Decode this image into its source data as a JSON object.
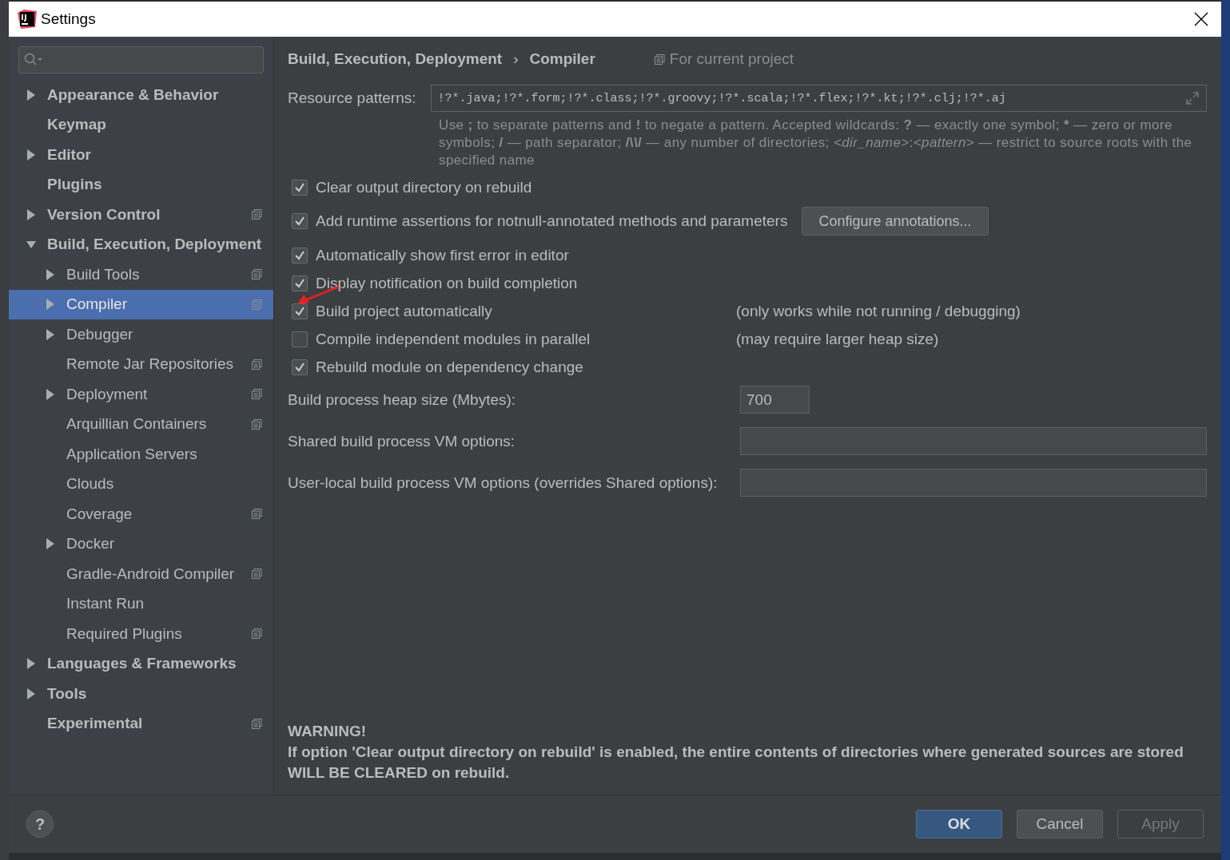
{
  "window": {
    "title": "Settings"
  },
  "sidebar": {
    "items": [
      {
        "label": "Appearance & Behavior",
        "expandable": true,
        "expanded": false,
        "selected": false,
        "project_scoped": false
      },
      {
        "label": "Keymap",
        "expandable": false,
        "selected": false,
        "project_scoped": false
      },
      {
        "label": "Editor",
        "expandable": true,
        "expanded": false,
        "selected": false,
        "project_scoped": false
      },
      {
        "label": "Plugins",
        "expandable": false,
        "selected": false,
        "project_scoped": false
      },
      {
        "label": "Version Control",
        "expandable": true,
        "expanded": false,
        "selected": false,
        "project_scoped": true
      },
      {
        "label": "Build, Execution, Deployment",
        "expandable": true,
        "expanded": true,
        "selected": false,
        "project_scoped": false,
        "children": [
          {
            "label": "Build Tools",
            "expandable": true,
            "expanded": false,
            "selected": false,
            "project_scoped": true
          },
          {
            "label": "Compiler",
            "expandable": true,
            "expanded": false,
            "selected": true,
            "project_scoped": true
          },
          {
            "label": "Debugger",
            "expandable": true,
            "expanded": false,
            "selected": false,
            "project_scoped": false
          },
          {
            "label": "Remote Jar Repositories",
            "expandable": false,
            "selected": false,
            "project_scoped": true
          },
          {
            "label": "Deployment",
            "expandable": true,
            "expanded": false,
            "selected": false,
            "project_scoped": true
          },
          {
            "label": "Arquillian Containers",
            "expandable": false,
            "selected": false,
            "project_scoped": true
          },
          {
            "label": "Application Servers",
            "expandable": false,
            "selected": false,
            "project_scoped": false
          },
          {
            "label": "Clouds",
            "expandable": false,
            "selected": false,
            "project_scoped": false
          },
          {
            "label": "Coverage",
            "expandable": false,
            "selected": false,
            "project_scoped": true
          },
          {
            "label": "Docker",
            "expandable": true,
            "expanded": false,
            "selected": false,
            "project_scoped": false
          },
          {
            "label": "Gradle-Android Compiler",
            "expandable": false,
            "selected": false,
            "project_scoped": true
          },
          {
            "label": "Instant Run",
            "expandable": false,
            "selected": false,
            "project_scoped": false
          },
          {
            "label": "Required Plugins",
            "expandable": false,
            "selected": false,
            "project_scoped": true
          }
        ]
      },
      {
        "label": "Languages & Frameworks",
        "expandable": true,
        "expanded": false,
        "selected": false,
        "project_scoped": false
      },
      {
        "label": "Tools",
        "expandable": true,
        "expanded": false,
        "selected": false,
        "project_scoped": false
      },
      {
        "label": "Experimental",
        "expandable": false,
        "selected": false,
        "project_scoped": true
      }
    ]
  },
  "breadcrumb": {
    "items": [
      "Build, Execution, Deployment",
      "Compiler"
    ],
    "separator": "›",
    "scope": "For current project"
  },
  "resource_patterns": {
    "label": "Resource patterns:",
    "value": "!?*.java;!?*.form;!?*.class;!?*.groovy;!?*.scala;!?*.flex;!?*.kt;!?*.clj;!?*.aj",
    "help": "Use **;** to separate patterns and **!** to negate a pattern. Accepted wildcards: **?** — exactly one symbol; ***** — zero or more symbols; **/** — path separator; **/\\*\\*/** — any number of directories;  *<dir_name>*:*<pattern>* — restrict to source roots with the specified name"
  },
  "options": [
    {
      "label": "Clear output directory on rebuild",
      "checked": true
    },
    {
      "label": "Add runtime assertions for notnull-annotated methods and parameters",
      "checked": true,
      "button": "Configure annotations..."
    },
    {
      "label": "Automatically show first error in editor",
      "checked": true
    },
    {
      "label": "Display notification on build completion",
      "checked": true
    },
    {
      "label": "Build project automatically",
      "checked": true,
      "note": "(only works while not running / debugging)",
      "annotated": true
    },
    {
      "label": "Compile independent modules in parallel",
      "checked": false,
      "note": "(may require larger heap size)"
    },
    {
      "label": "Rebuild module on dependency change",
      "checked": true
    }
  ],
  "fields": [
    {
      "label": "Build process heap size (Mbytes):",
      "value": "700",
      "kind": "short"
    },
    {
      "label": "Shared build process VM options:",
      "kind": "wide"
    },
    {
      "label": "User-local build process VM options (overrides Shared options):",
      "kind": "wide"
    }
  ],
  "warning": {
    "title": "WARNING!",
    "text": "If option 'Clear output directory on rebuild' is enabled, the entire contents of directories where generated sources are stored WILL BE CLEARED on rebuild."
  },
  "help_button": "?",
  "buttons": [
    {
      "label": "OK",
      "kind": "default",
      "disabled": false
    },
    {
      "label": "Cancel",
      "kind": "normal",
      "disabled": false
    },
    {
      "label": "Apply",
      "kind": "normal",
      "disabled": true
    }
  ]
}
